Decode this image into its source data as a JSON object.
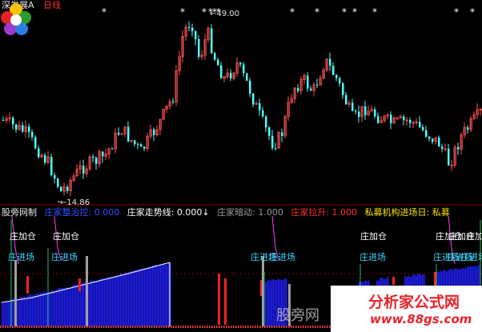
{
  "header": {
    "name": "深发展A",
    "period": "日线",
    "high_label": "←49.00",
    "low_label": "←14.86"
  },
  "indicator": {
    "name": "股旁网制",
    "items": [
      {
        "label": "庄家整治控: 0.000",
        "color": "#3050ff"
      },
      {
        "label": "庄家走势线: 0.000↓",
        "color": "#ffffff"
      },
      {
        "label": "庄家暗动: 1.000",
        "color": "#9a9a9a"
      },
      {
        "label": "庄家拉升: 1.000",
        "color": "#ff3030"
      },
      {
        "label": "私募机构进场日: 私募",
        "color": "#ffe000"
      }
    ]
  },
  "signals": {
    "add_label": "庄加仓",
    "enter_label": "庄进场"
  },
  "watermark": {
    "site_text": "股旁网",
    "brand": "分析家公式网",
    "url": "www.88gs.com"
  },
  "chart_data": {
    "type": "candlestick",
    "price_high": 49.0,
    "price_low": 14.86,
    "up_color": "#ff5050",
    "down_color": "#50ffff",
    "top_markers": 11,
    "series_indicator_colors": {
      "blue_bars": "#2020ff",
      "red_bars": "#ff2020",
      "white_line": "#ffffff",
      "magenta_line": "#ff40ff"
    }
  }
}
